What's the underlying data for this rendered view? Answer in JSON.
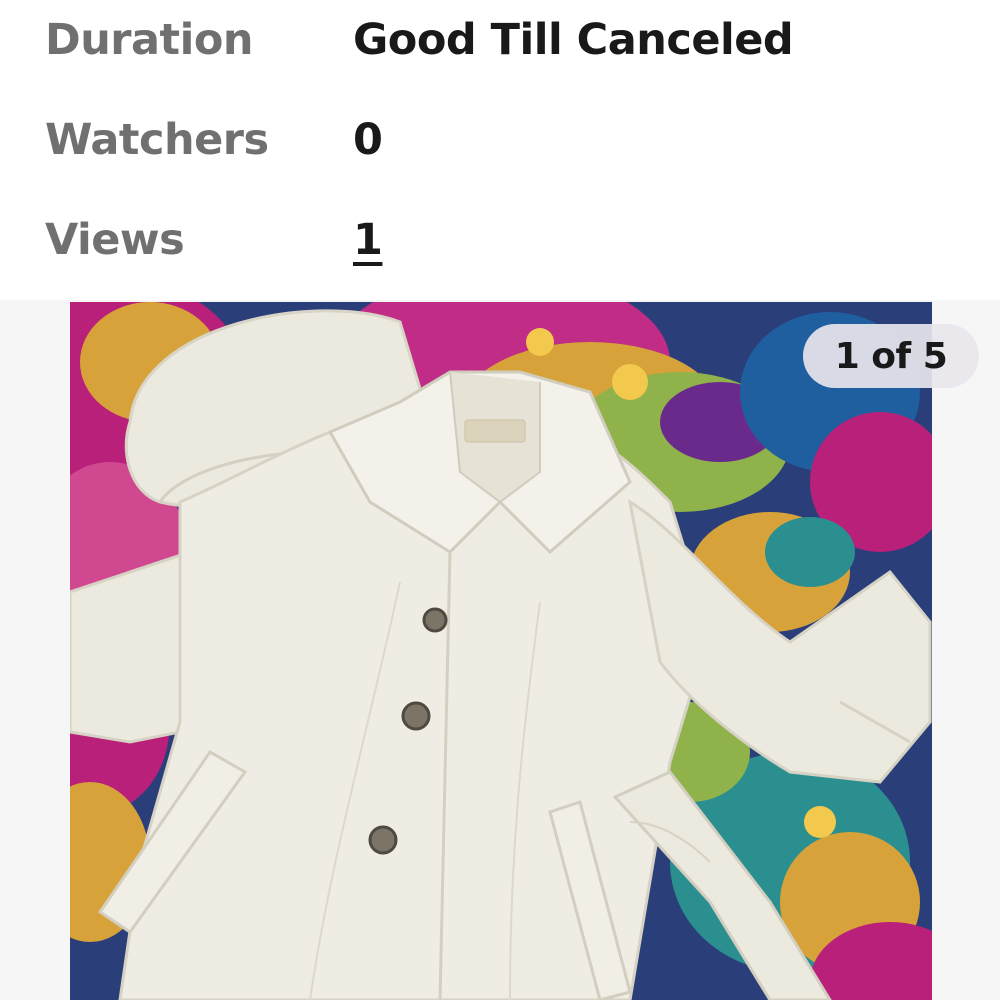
{
  "details": {
    "rows": [
      {
        "label": "Duration",
        "value": "Good Till Canceled"
      },
      {
        "label": "Watchers",
        "value": "0"
      },
      {
        "label": "Views",
        "value": "1"
      }
    ]
  },
  "gallery": {
    "counter": "1 of 5",
    "current_index": 1,
    "total": 5,
    "colors": {
      "coat": "#ece9df",
      "fabric_blue": "#2a3f7a",
      "fabric_magenta": "#b8207a",
      "fabric_gold": "#d8a23a",
      "fabric_green": "#8fb24a"
    }
  }
}
